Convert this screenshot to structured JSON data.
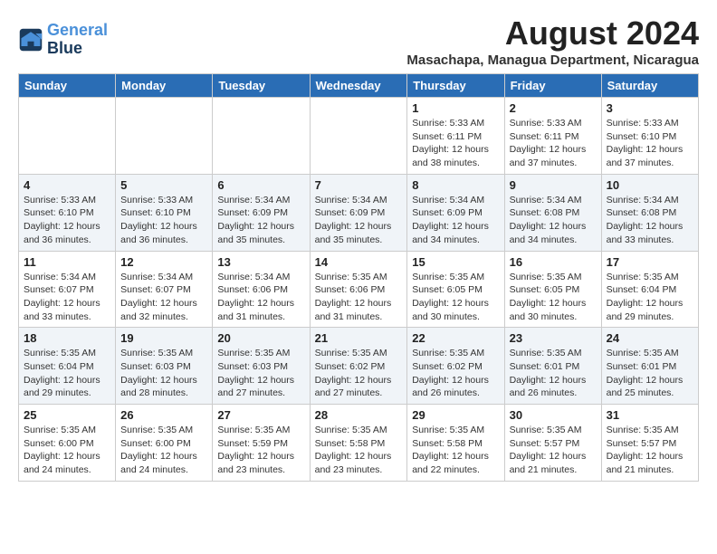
{
  "header": {
    "logo_line1": "General",
    "logo_line2": "Blue",
    "month_year": "August 2024",
    "location": "Masachapa, Managua Department, Nicaragua"
  },
  "weekdays": [
    "Sunday",
    "Monday",
    "Tuesday",
    "Wednesday",
    "Thursday",
    "Friday",
    "Saturday"
  ],
  "weeks": [
    [
      {
        "day": "",
        "info": ""
      },
      {
        "day": "",
        "info": ""
      },
      {
        "day": "",
        "info": ""
      },
      {
        "day": "",
        "info": ""
      },
      {
        "day": "1",
        "info": "Sunrise: 5:33 AM\nSunset: 6:11 PM\nDaylight: 12 hours\nand 38 minutes."
      },
      {
        "day": "2",
        "info": "Sunrise: 5:33 AM\nSunset: 6:11 PM\nDaylight: 12 hours\nand 37 minutes."
      },
      {
        "day": "3",
        "info": "Sunrise: 5:33 AM\nSunset: 6:10 PM\nDaylight: 12 hours\nand 37 minutes."
      }
    ],
    [
      {
        "day": "4",
        "info": "Sunrise: 5:33 AM\nSunset: 6:10 PM\nDaylight: 12 hours\nand 36 minutes."
      },
      {
        "day": "5",
        "info": "Sunrise: 5:33 AM\nSunset: 6:10 PM\nDaylight: 12 hours\nand 36 minutes."
      },
      {
        "day": "6",
        "info": "Sunrise: 5:34 AM\nSunset: 6:09 PM\nDaylight: 12 hours\nand 35 minutes."
      },
      {
        "day": "7",
        "info": "Sunrise: 5:34 AM\nSunset: 6:09 PM\nDaylight: 12 hours\nand 35 minutes."
      },
      {
        "day": "8",
        "info": "Sunrise: 5:34 AM\nSunset: 6:09 PM\nDaylight: 12 hours\nand 34 minutes."
      },
      {
        "day": "9",
        "info": "Sunrise: 5:34 AM\nSunset: 6:08 PM\nDaylight: 12 hours\nand 34 minutes."
      },
      {
        "day": "10",
        "info": "Sunrise: 5:34 AM\nSunset: 6:08 PM\nDaylight: 12 hours\nand 33 minutes."
      }
    ],
    [
      {
        "day": "11",
        "info": "Sunrise: 5:34 AM\nSunset: 6:07 PM\nDaylight: 12 hours\nand 33 minutes."
      },
      {
        "day": "12",
        "info": "Sunrise: 5:34 AM\nSunset: 6:07 PM\nDaylight: 12 hours\nand 32 minutes."
      },
      {
        "day": "13",
        "info": "Sunrise: 5:34 AM\nSunset: 6:06 PM\nDaylight: 12 hours\nand 31 minutes."
      },
      {
        "day": "14",
        "info": "Sunrise: 5:35 AM\nSunset: 6:06 PM\nDaylight: 12 hours\nand 31 minutes."
      },
      {
        "day": "15",
        "info": "Sunrise: 5:35 AM\nSunset: 6:05 PM\nDaylight: 12 hours\nand 30 minutes."
      },
      {
        "day": "16",
        "info": "Sunrise: 5:35 AM\nSunset: 6:05 PM\nDaylight: 12 hours\nand 30 minutes."
      },
      {
        "day": "17",
        "info": "Sunrise: 5:35 AM\nSunset: 6:04 PM\nDaylight: 12 hours\nand 29 minutes."
      }
    ],
    [
      {
        "day": "18",
        "info": "Sunrise: 5:35 AM\nSunset: 6:04 PM\nDaylight: 12 hours\nand 29 minutes."
      },
      {
        "day": "19",
        "info": "Sunrise: 5:35 AM\nSunset: 6:03 PM\nDaylight: 12 hours\nand 28 minutes."
      },
      {
        "day": "20",
        "info": "Sunrise: 5:35 AM\nSunset: 6:03 PM\nDaylight: 12 hours\nand 27 minutes."
      },
      {
        "day": "21",
        "info": "Sunrise: 5:35 AM\nSunset: 6:02 PM\nDaylight: 12 hours\nand 27 minutes."
      },
      {
        "day": "22",
        "info": "Sunrise: 5:35 AM\nSunset: 6:02 PM\nDaylight: 12 hours\nand 26 minutes."
      },
      {
        "day": "23",
        "info": "Sunrise: 5:35 AM\nSunset: 6:01 PM\nDaylight: 12 hours\nand 26 minutes."
      },
      {
        "day": "24",
        "info": "Sunrise: 5:35 AM\nSunset: 6:01 PM\nDaylight: 12 hours\nand 25 minutes."
      }
    ],
    [
      {
        "day": "25",
        "info": "Sunrise: 5:35 AM\nSunset: 6:00 PM\nDaylight: 12 hours\nand 24 minutes."
      },
      {
        "day": "26",
        "info": "Sunrise: 5:35 AM\nSunset: 6:00 PM\nDaylight: 12 hours\nand 24 minutes."
      },
      {
        "day": "27",
        "info": "Sunrise: 5:35 AM\nSunset: 5:59 PM\nDaylight: 12 hours\nand 23 minutes."
      },
      {
        "day": "28",
        "info": "Sunrise: 5:35 AM\nSunset: 5:58 PM\nDaylight: 12 hours\nand 23 minutes."
      },
      {
        "day": "29",
        "info": "Sunrise: 5:35 AM\nSunset: 5:58 PM\nDaylight: 12 hours\nand 22 minutes."
      },
      {
        "day": "30",
        "info": "Sunrise: 5:35 AM\nSunset: 5:57 PM\nDaylight: 12 hours\nand 21 minutes."
      },
      {
        "day": "31",
        "info": "Sunrise: 5:35 AM\nSunset: 5:57 PM\nDaylight: 12 hours\nand 21 minutes."
      }
    ]
  ]
}
